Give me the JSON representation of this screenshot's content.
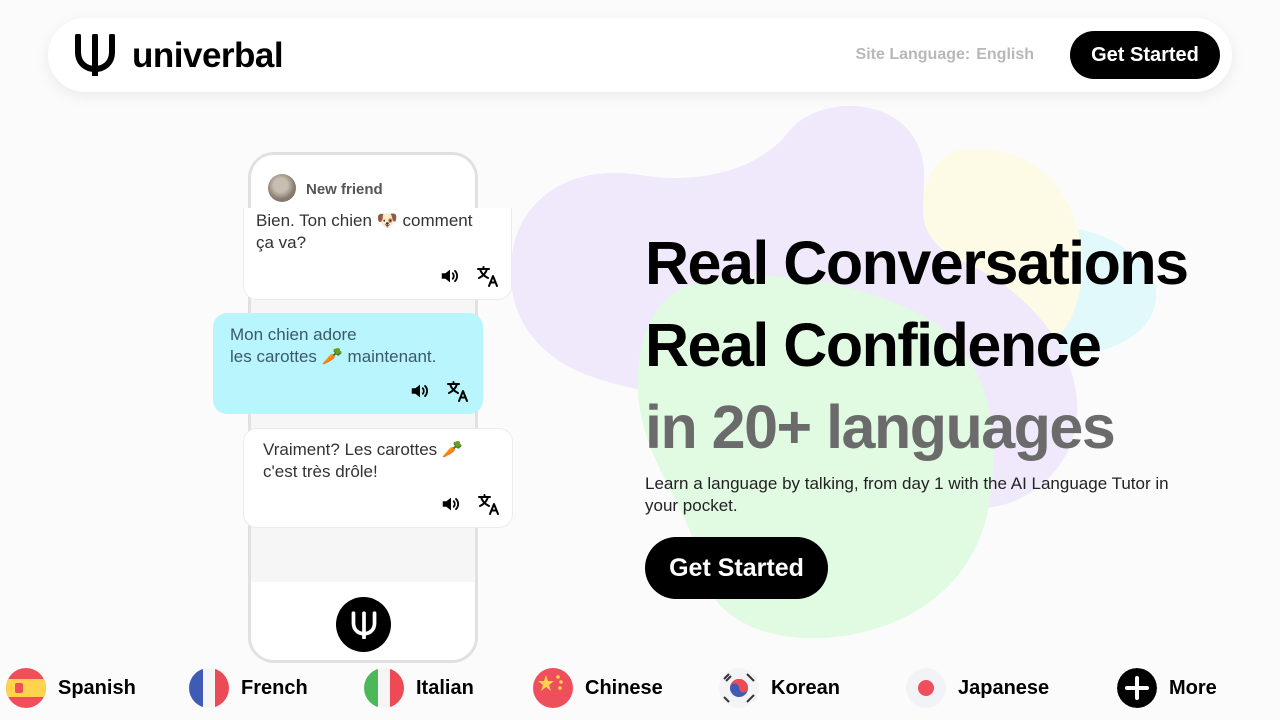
{
  "brand": {
    "name": "univerbal"
  },
  "header": {
    "site_language_label": "Site Language:",
    "site_language_value": "English",
    "cta_label": "Get Started"
  },
  "chat": {
    "contact_name": "New friend",
    "messages": [
      {
        "from": "friend",
        "line1": "Bien. Ton chien 🐶 comment",
        "line2": "ça va?"
      },
      {
        "from": "user",
        "line1": "Mon chien adore",
        "line2": "les carottes 🥕 maintenant."
      },
      {
        "from": "friend",
        "line1": "Vraiment? Les carottes 🥕",
        "line2": "c'est très drôle!"
      }
    ]
  },
  "hero": {
    "line1": "Real Conversations",
    "line2": "Real Confidence",
    "line3": "in 20+ languages",
    "subtitle": "Learn a language by talking, from day 1 with the AI Language Tutor in your pocket.",
    "cta_label": "Get Started"
  },
  "languages": [
    {
      "label": "Spanish",
      "flag": "spain-flag-icon"
    },
    {
      "label": "French",
      "flag": "france-flag-icon"
    },
    {
      "label": "Italian",
      "flag": "italy-flag-icon"
    },
    {
      "label": "Chinese",
      "flag": "china-flag-icon"
    },
    {
      "label": "Korean",
      "flag": "korea-flag-icon"
    },
    {
      "label": "Japanese",
      "flag": "japan-flag-icon"
    },
    {
      "label": "More",
      "flag": "plus-icon"
    }
  ],
  "colors": {
    "accent_black": "#000000",
    "user_bubble": "#b8f5fd",
    "blob_purple": "#efe9fb",
    "blob_green": "#e1fbe3",
    "blob_yellow": "#fdfbe6",
    "blob_cyan": "#e2f9fc"
  }
}
